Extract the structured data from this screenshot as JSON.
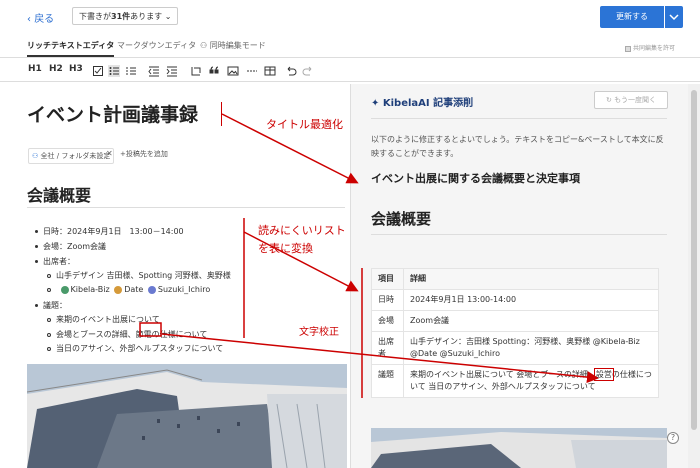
{
  "header": {
    "back_label": "戻る",
    "drafts_prefix": "下書きが",
    "drafts_count": "31件",
    "drafts_suffix": "あります",
    "update_label": "更新する"
  },
  "tabs": [
    {
      "label": "リッチテキストエディタ",
      "active": true
    },
    {
      "label": "マークダウンエディタ",
      "active": false
    },
    {
      "label": "同時編集モード",
      "active": false
    }
  ],
  "collab_label": "共同編集を許可",
  "toolbar": {
    "h1": "H1",
    "h2": "H2",
    "h3": "H3"
  },
  "editor": {
    "title": "イベント計画議事録",
    "chip_label": "全社 / フォルダ未設定",
    "add_post_label": "+投稿先を追加",
    "section_title": "会議概要",
    "items": {
      "date": "日時：2024年9月1日　13:00－14:00",
      "venue": "会場：Zoom会議",
      "attendees": "出席者：",
      "attendee_company": "山手デザイン 吉田様、Spotting 河野様、奥野様",
      "attendee_kibela": "Kibela-Biz",
      "attendee_date": "Date",
      "attendee_suzuki": "Suzuki_Ichiro",
      "agenda": "議題：",
      "agenda_1": "来期のイベント出展について",
      "agenda_2_a": "会場とブースの詳細、",
      "agenda_2_typo": "節電",
      "agenda_2_b": "の仕様について",
      "agenda_3": "当日のアサイン、外部ヘルプスタッフについて"
    }
  },
  "ai": {
    "title": "KibelaAI 記事添削",
    "retry_label": "もう一度聞く",
    "desc": "以下のように修正するとよいでしょう。テキストをコピー&ペーストして本文に反映することができます。",
    "h3": "イベント出展に関する会議概要と決定事項",
    "h2": "会議概要",
    "table_head": [
      "項目",
      "詳細"
    ],
    "rows": [
      {
        "k": "日時",
        "v": "2024年9月1日 13:00-14:00"
      },
      {
        "k": "会場",
        "v": "Zoom会議"
      },
      {
        "k": "出席者",
        "v": "山手デザイン：吉田様 Spotting：河野様、奥野様 @Kibela-Biz @Date @Suzuki_Ichiro"
      }
    ],
    "agenda_key": "議題",
    "agenda_a": "来期のイベント出展について 会場とブースの詳細、",
    "agenda_fix": "設営",
    "agenda_b": "の仕様について 当日のアサイン、外部ヘルプスタッフについて",
    "help": "?"
  },
  "annotations": {
    "title_opt": "タイトル最適化",
    "list_to_table_1": "読みにくいリスト",
    "list_to_table_2": "を表に変換",
    "proofread": "文字校正"
  },
  "colors": {
    "accent": "#2b74d6",
    "annotation": "#cc0000"
  }
}
